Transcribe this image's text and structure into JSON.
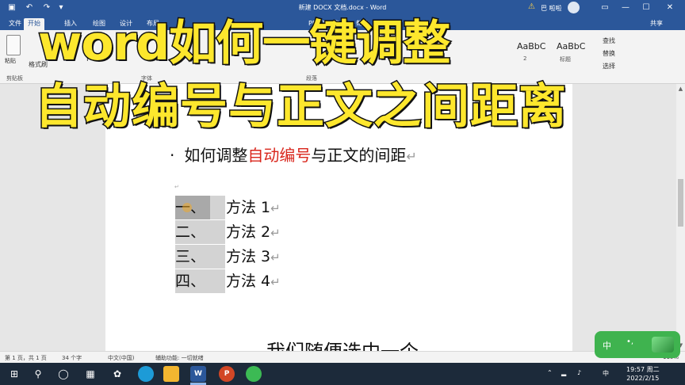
{
  "window": {
    "title": "新建 DOCX 文档.docx - Word",
    "user": "巴 啦啦",
    "controls": {
      "minimize": "—",
      "maximize": "☐",
      "close": "✕"
    }
  },
  "tabs": [
    "文件",
    "开始",
    "插入",
    "绘图",
    "设计",
    "布局",
    "PDF工具集",
    "帮助"
  ],
  "share_label": "共享",
  "ribbon": {
    "paste_label": "粘贴",
    "format_painter": "格式刷",
    "clipboard_group": "剪贴板",
    "font_group": "字体",
    "paragraph_group": "段落",
    "format_buttons": "B I U",
    "style_1": "AaBbC",
    "style_2": "AaBbC",
    "style_1_name": "2",
    "style_2_name": "标题",
    "edit_items": [
      "查找",
      "替换",
      "选择"
    ]
  },
  "overlay": {
    "line1": "word如何一键调整",
    "line2": "自动编号与正文之间距离"
  },
  "document": {
    "heading_bullet": "·",
    "heading_prefix": "如何调整",
    "heading_red": "自动编号",
    "heading_suffix": "与正文的间距",
    "paragraph_mark": "↵",
    "small_mark": "↵",
    "list": [
      {
        "num": "一、",
        "text": "方法 1"
      },
      {
        "num": "二、",
        "text": "方法 2"
      },
      {
        "num": "三、",
        "text": "方法 3"
      },
      {
        "num": "四、",
        "text": "方法 4"
      }
    ]
  },
  "subtitle": "我们随便选中一个",
  "widget": {
    "lang": "中",
    "dot": "•,"
  },
  "statusbar": {
    "page": "第 1 页，共 1 页",
    "words": "34 个字",
    "lang": "中文(中国)",
    "accessibility": "辅助功能: 一切就绪",
    "zoom": "110%"
  },
  "taskbar": {
    "time": "19:57 周二",
    "date": "2022/2/15",
    "tray_lang": "中",
    "word_label": "W",
    "ppt_label": "P"
  }
}
